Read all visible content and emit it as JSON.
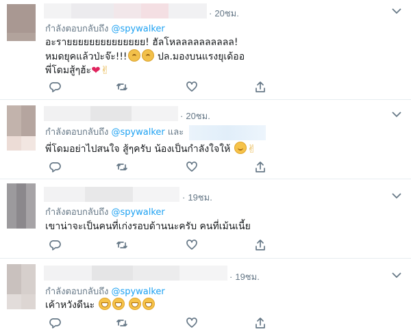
{
  "reply_prefix": "กำลังตอบกลับถึง",
  "and_word": "และ",
  "colors": {
    "link": "#1da1f2",
    "secondary": "#657786",
    "border": "#e6ecf0",
    "text": "#14171a"
  },
  "icons": [
    "reply-icon",
    "retweet-icon",
    "like-icon",
    "share-icon",
    "chevron-down-icon"
  ],
  "tweets": [
    {
      "time": "20ชม.",
      "handle": "@spywalker",
      "lines": [
        "อะรายยยยยยยยยยยยยย! ฮัลโหลลลลลลลลลล!",
        "หมดยุคแล้วป่ะจ๊ะ!!!",
        "ปล.มองบนแรงยุเด้ออ",
        "พี่โดมสู้ๆฮ้ะ"
      ]
    },
    {
      "time": "20ชม.",
      "handle": "@spywalker",
      "lines": [
        "พี่โดมอย่าไปสนใจ สู้ๆครับ น้องเป็นกำลังใจให้"
      ]
    },
    {
      "time": "19ชม.",
      "handle": "@spywalker",
      "lines": [
        "เขาน่าจะเป็นคนที่เก่งรอบด้านนะครับ คนที่เม้นเนี้ย"
      ]
    },
    {
      "time": "19ชม.",
      "handle": "@spywalker",
      "lines": [
        "เค้าหวังดีนะ"
      ]
    }
  ]
}
